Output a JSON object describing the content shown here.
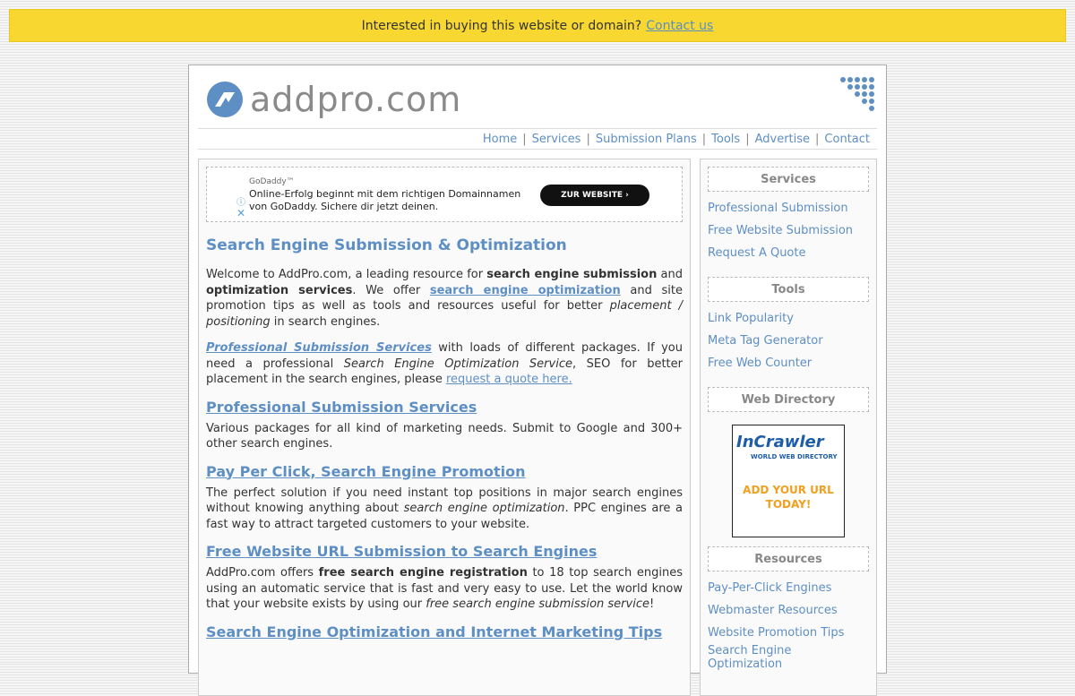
{
  "topbar": {
    "text": "Interested in buying this website or domain?",
    "link": "Contact us"
  },
  "logo": {
    "text": "addpro.com"
  },
  "nav": [
    "Home",
    "Services",
    "Submission Plans",
    "Tools",
    "Advertise",
    "Contact"
  ],
  "ad": {
    "brand": "GoDaddy™",
    "text": "Online-Erfolg beginnt mit dem richtigen Domainnamen von GoDaddy. Sichere dir jetzt deinen.",
    "button": "ZUR WEBSITE",
    "info": "ⓘ",
    "close": "✕"
  },
  "content": {
    "title": "Search Engine Submission & Optimization",
    "intro": {
      "t1": "Welcome to AddPro.com, a leading resource for ",
      "b1": "search engine submission",
      "t2": " and ",
      "b2": "optimization services",
      "t3": ". We offer ",
      "l1": "search engine optimization",
      "t4": " and site promotion tips as well as tools and resources useful for better ",
      "i1": "placement / positioning",
      "t5": " in search engines."
    },
    "pro": {
      "l1": "Professional Submission Services",
      "t1": " with loads of different packages. If you need a professional ",
      "i1": "Search Engine Optimization Service",
      "t2": ", SEO for better placement in the search engines, please ",
      "l2": "request a quote here."
    },
    "sections": [
      {
        "heading": "Professional Submission Services",
        "text": "Various packages for all kind of marketing needs. Submit to Google and 300+ other search engines."
      },
      {
        "heading": "Pay Per Click, Search Engine Promotion",
        "t1": "The perfect solution if you need instant top positions in major search engines without knowing anything about ",
        "i1": "search engine optimization",
        "t2": ". PPC engines are a fast way to attract targeted customers to your website."
      },
      {
        "heading": "Free Website URL Submission to Search Engines",
        "t1": "AddPro.com offers ",
        "b1": "free search engine registration",
        "t2": " to 18 top search engines using an automatic service that is fast and very easy to use. Let the world know that your website exists by using our ",
        "i1": "free search engine submission service",
        "t3": "!"
      },
      {
        "heading": "Search Engine Optimization and Internet Marketing Tips"
      }
    ]
  },
  "sidebar": {
    "services": {
      "head": "Services",
      "items": [
        "Professional Submission",
        "Free Website Submission",
        "Request A Quote"
      ]
    },
    "tools": {
      "head": "Tools",
      "items": [
        "Link Popularity",
        "Meta Tag Generator",
        "Free Web Counter"
      ]
    },
    "directory": {
      "head": "Web Directory",
      "banner_logo": "InCrawler",
      "banner_sub": "WORLD WEB DIRECTORY",
      "banner_cta": "ADD YOUR URL TODAY!"
    },
    "resources": {
      "head": "Resources",
      "items": [
        "Pay-Per-Click Engines",
        "Webmaster Resources",
        "Website Promotion Tips",
        "Search Engine Optimization"
      ]
    }
  }
}
